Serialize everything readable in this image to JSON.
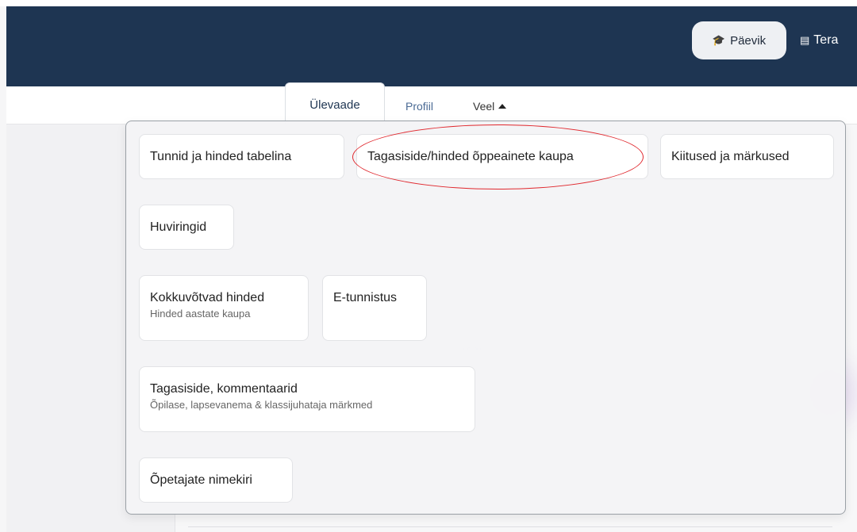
{
  "header": {
    "nav_pill_label": "Päevik",
    "nav_link_label": "Tera",
    "icons": {
      "pill_icon": "graduation-cap-icon",
      "link_icon": "book-icon"
    }
  },
  "tabs": {
    "active_label": "Ülevaade",
    "profile_label": "Profiil",
    "more_label": "Veel"
  },
  "dropdown": {
    "items": [
      {
        "label": "Tunnid ja hinded tabelina",
        "sublabel": ""
      },
      {
        "label": "Tagasiside/hinded õppeainete kaupa",
        "sublabel": ""
      },
      {
        "label": "Kiitused ja märkused",
        "sublabel": ""
      },
      {
        "label": "Huviringid",
        "sublabel": ""
      },
      {
        "label": "Kokkuvõtvad hinded",
        "sublabel": "Hinded aastate kaupa"
      },
      {
        "label": "E-tunnistus",
        "sublabel": ""
      },
      {
        "label": "Tagasiside, kommentaarid",
        "sublabel": "Õpilase, lapsevanema & klassijuhataja märkmed"
      },
      {
        "label": "Õpetajate nimekiri",
        "sublabel": ""
      }
    ]
  },
  "colors": {
    "header_bg": "#1e3552",
    "annotation": "#e0282e",
    "active_tab_text": "#1e3552"
  }
}
